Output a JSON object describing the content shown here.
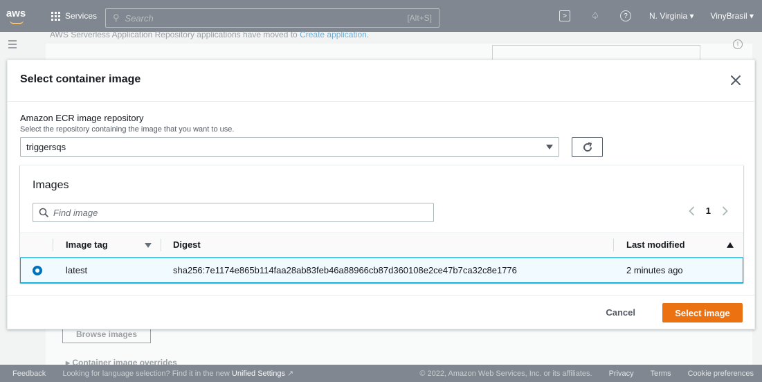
{
  "topnav": {
    "logo": "aws",
    "services_label": "Services",
    "search_placeholder": "Search",
    "search_shortcut": "[Alt+S]",
    "region": "N. Virginia ▾",
    "account": "VinyBrasil ▾"
  },
  "background": {
    "notice_text": "AWS Serverless Application Repository applications have moved to ",
    "notice_link": "Create application",
    "notice_end": ".",
    "browse_button": "Browse images",
    "overrides_label": "▸ Container image overrides"
  },
  "modal": {
    "title": "Select container image",
    "repo_label": "Amazon ECR image repository",
    "repo_description": "Select the repository containing the image that you want to use.",
    "repo_selected": "triggersqs",
    "images": {
      "title": "Images",
      "search_placeholder": "Find image",
      "current_page": "1",
      "columns": {
        "tag": "Image tag",
        "digest": "Digest",
        "modified": "Last modified"
      },
      "rows": [
        {
          "selected": true,
          "tag": "latest",
          "digest": "sha256:7e1174e865b114faa28ab83feb46a88966cb87d360108e2ce47b7ca32c8e1776",
          "modified": "2 minutes ago"
        }
      ]
    },
    "cancel_label": "Cancel",
    "confirm_label": "Select image"
  },
  "footer": {
    "feedback": "Feedback",
    "lang_text": "Looking for language selection? Find it in the new ",
    "lang_link": "Unified Settings",
    "copyright": "© 2022, Amazon Web Services, Inc. or its affiliates.",
    "privacy": "Privacy",
    "terms": "Terms",
    "cookies": "Cookie preferences"
  },
  "colors": {
    "primary_button": "#ec7211",
    "selected_row_bg": "#f1faff",
    "selected_row_border": "#00a1c9",
    "link": "#0073bb",
    "nav_bg": "#232f3e"
  }
}
